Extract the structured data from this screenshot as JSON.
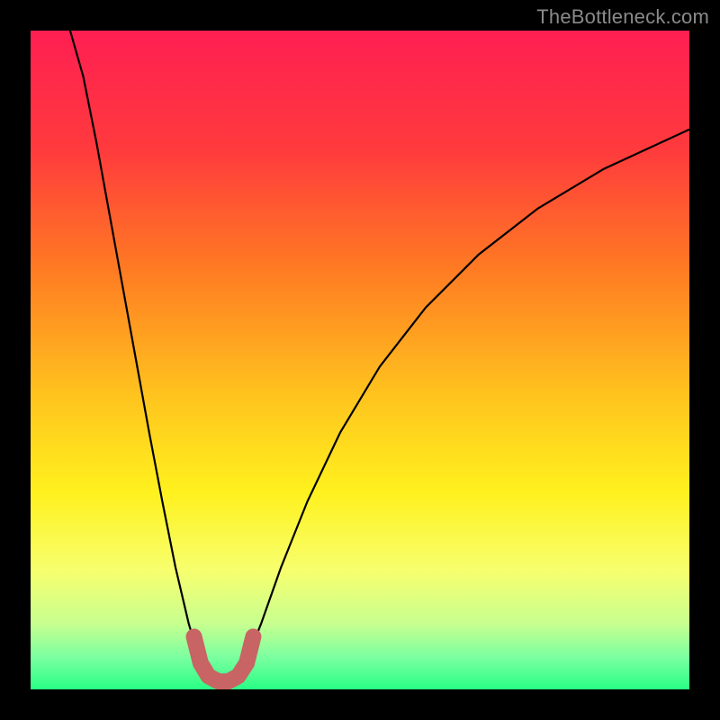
{
  "watermark": "TheBottleneck.com",
  "chart_data": {
    "type": "line",
    "title": "",
    "xlabel": "",
    "ylabel": "",
    "xlim": [
      0,
      1
    ],
    "ylim": [
      0,
      1
    ],
    "background_gradient_stops": [
      {
        "offset": 0.0,
        "color": "#ff1f52"
      },
      {
        "offset": 0.18,
        "color": "#ff3a3d"
      },
      {
        "offset": 0.36,
        "color": "#ff7a23"
      },
      {
        "offset": 0.55,
        "color": "#ffc21e"
      },
      {
        "offset": 0.7,
        "color": "#fff11e"
      },
      {
        "offset": 0.82,
        "color": "#f7ff6e"
      },
      {
        "offset": 0.9,
        "color": "#c8ff8f"
      },
      {
        "offset": 0.95,
        "color": "#7dffa0"
      },
      {
        "offset": 1.0,
        "color": "#29ff85"
      }
    ],
    "series": [
      {
        "name": "bottleneck-curve",
        "stroke": "#000000",
        "stroke_width": 2.2,
        "points": [
          {
            "x": 0.06,
            "y": 1.0
          },
          {
            "x": 0.08,
            "y": 0.93
          },
          {
            "x": 0.1,
            "y": 0.83
          },
          {
            "x": 0.12,
            "y": 0.72
          },
          {
            "x": 0.14,
            "y": 0.61
          },
          {
            "x": 0.16,
            "y": 0.5
          },
          {
            "x": 0.18,
            "y": 0.39
          },
          {
            "x": 0.2,
            "y": 0.285
          },
          {
            "x": 0.22,
            "y": 0.185
          },
          {
            "x": 0.24,
            "y": 0.1
          },
          {
            "x": 0.255,
            "y": 0.05
          },
          {
            "x": 0.27,
            "y": 0.02
          },
          {
            "x": 0.285,
            "y": 0.01
          },
          {
            "x": 0.3,
            "y": 0.01
          },
          {
            "x": 0.315,
            "y": 0.02
          },
          {
            "x": 0.33,
            "y": 0.05
          },
          {
            "x": 0.35,
            "y": 0.1
          },
          {
            "x": 0.38,
            "y": 0.185
          },
          {
            "x": 0.42,
            "y": 0.285
          },
          {
            "x": 0.47,
            "y": 0.39
          },
          {
            "x": 0.53,
            "y": 0.49
          },
          {
            "x": 0.6,
            "y": 0.58
          },
          {
            "x": 0.68,
            "y": 0.66
          },
          {
            "x": 0.77,
            "y": 0.73
          },
          {
            "x": 0.87,
            "y": 0.79
          },
          {
            "x": 1.0,
            "y": 0.85
          }
        ]
      },
      {
        "name": "trough-highlight",
        "stroke": "#c86464",
        "stroke_width": 18,
        "linecap": "round",
        "points": [
          {
            "x": 0.248,
            "y": 0.08
          },
          {
            "x": 0.258,
            "y": 0.04
          },
          {
            "x": 0.27,
            "y": 0.02
          },
          {
            "x": 0.285,
            "y": 0.012
          },
          {
            "x": 0.3,
            "y": 0.012
          },
          {
            "x": 0.315,
            "y": 0.02
          },
          {
            "x": 0.328,
            "y": 0.04
          },
          {
            "x": 0.338,
            "y": 0.08
          }
        ]
      }
    ]
  }
}
